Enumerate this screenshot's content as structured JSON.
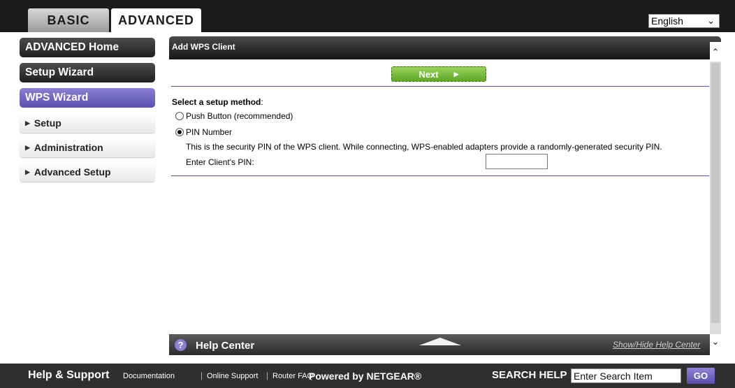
{
  "top_tabs": [
    {
      "label": "BASIC",
      "active": false
    },
    {
      "label": "ADVANCED",
      "active": true
    }
  ],
  "language": {
    "selected": "English"
  },
  "sidebar": {
    "items": [
      {
        "label": "ADVANCED Home"
      },
      {
        "label": "Setup Wizard"
      },
      {
        "label": "WPS Wizard"
      },
      {
        "label": "Setup"
      },
      {
        "label": "Administration"
      },
      {
        "label": "Advanced Setup"
      }
    ]
  },
  "panel": {
    "title": "Add WPS Client",
    "next_label": "Next",
    "setup_method_label": "Select a setup method",
    "setup_method_colon": ":",
    "options": [
      {
        "label": "Push Button (recommended)",
        "checked": false
      },
      {
        "label": "PIN Number",
        "checked": true
      }
    ],
    "pin_description": "This is the security PIN of the WPS client. While connecting, WPS-enabled adapters provide a randomly-generated security PIN.",
    "pin_label": "Enter Client's PIN:",
    "pin_value": ""
  },
  "help_center": {
    "title": "Help Center",
    "toggle_link": "Show/Hide Help Center"
  },
  "footer": {
    "help_support": "Help & Support",
    "links": [
      "Documentation",
      "Online Support",
      "Router FAQ"
    ],
    "separator": "|",
    "powered_by": "Powered by NETGEAR®",
    "search_label": "SEARCH HELP",
    "search_placeholder": "Enter Search Item",
    "go_label": "GO"
  },
  "colors": {
    "accent_purple": "#5a4fae",
    "next_green": "#7cbc3e",
    "dark_bar": "#2f2f2f"
  }
}
